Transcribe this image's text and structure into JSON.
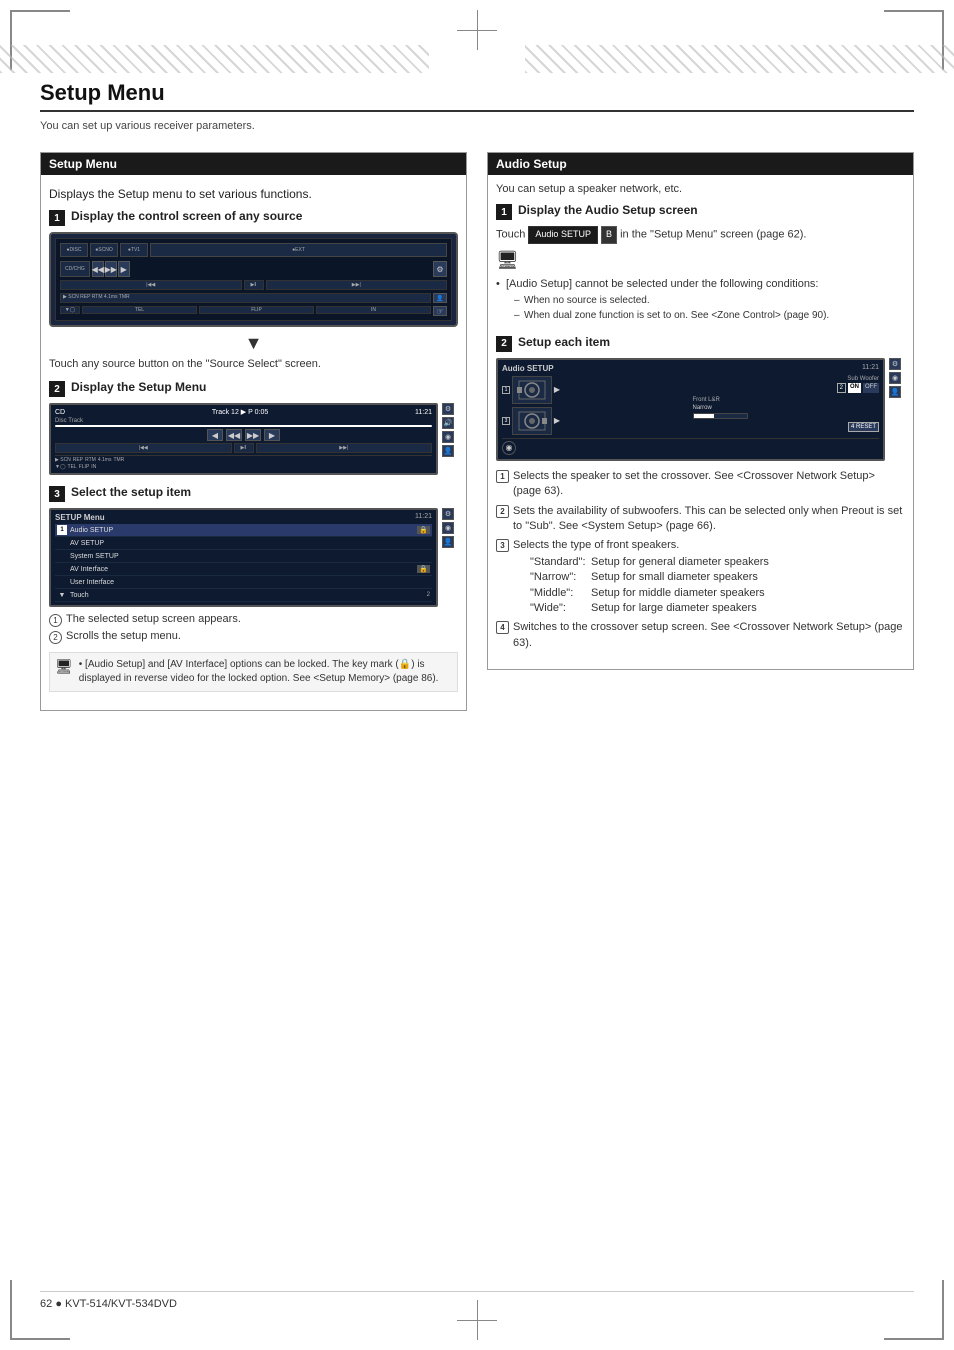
{
  "page": {
    "title": "Setup Menu",
    "subtitle": "You can set up various receiver parameters.",
    "footer": {
      "page_number": "62",
      "bullet": "●",
      "model": "KVT-514/KVT-534DVD"
    }
  },
  "left_section": {
    "header": "Setup Menu",
    "description": "Displays the Setup menu to set various functions.",
    "step1": {
      "number": "1",
      "label": "Display the control screen of any source"
    },
    "step1_desc": "Touch any source button on the \"Source Select\" screen.",
    "step2": {
      "number": "2",
      "label": "Display the Setup Menu"
    },
    "step3": {
      "number": "3",
      "label": "Select the setup item"
    },
    "setup_screen": {
      "title": "SETUP Menu",
      "time": "11:21",
      "items": [
        {
          "name": "Audio SETUP",
          "icon": "🔒",
          "num": "1",
          "highlighted": true
        },
        {
          "name": "AV SETUP",
          "icon": ""
        },
        {
          "name": "System SETUP",
          "icon": ""
        },
        {
          "name": "AV Interface",
          "icon": "🔒"
        },
        {
          "name": "User Interface",
          "icon": ""
        },
        {
          "name": "Touch",
          "icon": ""
        }
      ]
    },
    "setup_notes": [
      {
        "num": "1",
        "text": "The selected setup screen appears."
      },
      {
        "num": "2",
        "text": "Scrolls the setup menu."
      }
    ],
    "note_text": "• [Audio Setup]  and [AV Interface] options can be locked. The key mark (🔒) is displayed in reverse video for the locked option. See <Setup Memory> (page 86)."
  },
  "right_section": {
    "header": "Audio Setup",
    "description": "You can setup a speaker network, etc.",
    "step1": {
      "number": "1",
      "label": "Display the Audio Setup screen"
    },
    "touch_instruction": "Touch",
    "button_label": "Audio SETUP",
    "button_suffix": "in the \"Setup Menu\" screen (page 62).",
    "note_text": "• [Audio Setup] cannot be selected under the following conditions:\n– When no source is selected.\n– When dual zone function is set to on. See <Zone Control> (page 90).",
    "step2": {
      "number": "2",
      "label": "Setup each item"
    },
    "audio_screen": {
      "title": "Audio SETUP",
      "time": "11:21",
      "subwoofer_label": "Sub Woofer",
      "btn_2_label": "2",
      "btn_on": "ON",
      "btn_off": "OFF",
      "front_lr_label": "Front L&R",
      "narrow_label": "Narrow"
    },
    "annotations": [
      {
        "num": "1",
        "text": "Selects the speaker to set the crossover. See <Crossover Network Setup> (page 63)."
      },
      {
        "num": "2",
        "text": "Sets the availability of subwoofers. This can be selected only when Preout is set to \"Sub\". See <System Setup> (page 66)."
      },
      {
        "num": "3",
        "text": "Selects the type of front speakers.",
        "indent": [
          {
            "label": "\"Standard\":",
            "desc": "Setup for general diameter speakers"
          },
          {
            "label": "\"Narrow\":",
            "desc": "Setup for small diameter speakers"
          },
          {
            "label": "\"Middle\":",
            "desc": "Setup for middle diameter speakers"
          },
          {
            "label": "\"Wide\":",
            "desc": "Setup for large diameter speakers"
          }
        ]
      },
      {
        "num": "4",
        "text": "Switches to the crossover setup screen. See <Crossover Network Setup> (page 63)."
      }
    ]
  }
}
